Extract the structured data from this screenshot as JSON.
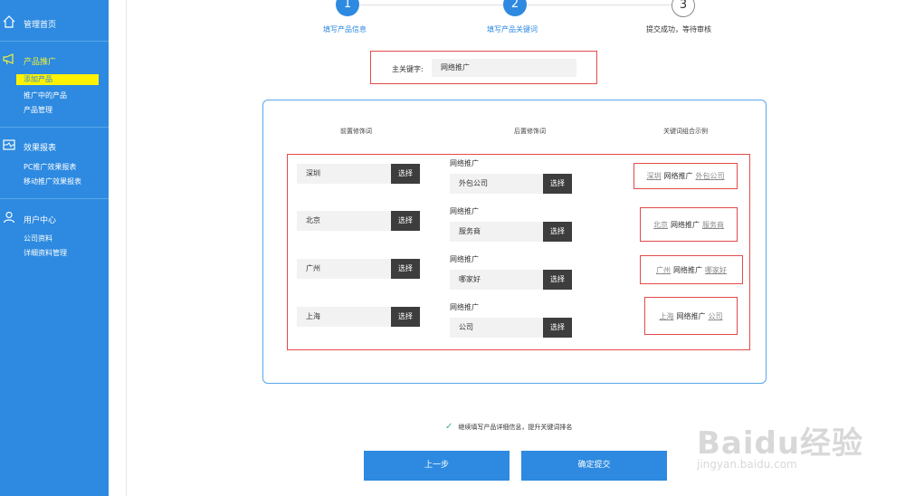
{
  "sidebar": {
    "sections": [
      {
        "label": "管理首页",
        "icon": "home-icon",
        "items": []
      },
      {
        "label": "产品推广",
        "icon": "megaphone-icon",
        "items": [
          "添加产品",
          "推广中的产品",
          "产品管理"
        ]
      },
      {
        "label": "效果报表",
        "icon": "report-icon",
        "items": [
          "PC推广效果报表",
          "移动推广效果报表"
        ]
      },
      {
        "label": "用户中心",
        "icon": "user-icon",
        "items": [
          "公司资料",
          "详细资料管理"
        ]
      }
    ]
  },
  "steps": [
    {
      "num": "1",
      "label": "填写产品信息"
    },
    {
      "num": "2",
      "label": "填写产品关键词"
    },
    {
      "num": "3",
      "label": "提交成功，等待审核"
    }
  ],
  "keyword": {
    "label": "主关键字:",
    "value": "网络推广"
  },
  "columns": {
    "prefix": "前置修饰词",
    "suffix": "后置修饰词",
    "example": "关键词组合示例"
  },
  "select_label": "选择",
  "rows": [
    {
      "prefix": "深圳",
      "keyword": "网络推广",
      "suffix": "外包公司"
    },
    {
      "prefix": "北京",
      "keyword": "网络推广",
      "suffix": "服务商"
    },
    {
      "prefix": "广州",
      "keyword": "网络推广",
      "suffix": "哪家好"
    },
    {
      "prefix": "上海",
      "keyword": "网络推广",
      "suffix": "公司"
    }
  ],
  "hint": "继续填写产品详细信息，提升关键词排名",
  "buttons": {
    "prev": "上一步",
    "submit": "确定提交"
  },
  "watermark": {
    "brand": "Baidu经验",
    "url": "jingyan.baidu.com"
  }
}
